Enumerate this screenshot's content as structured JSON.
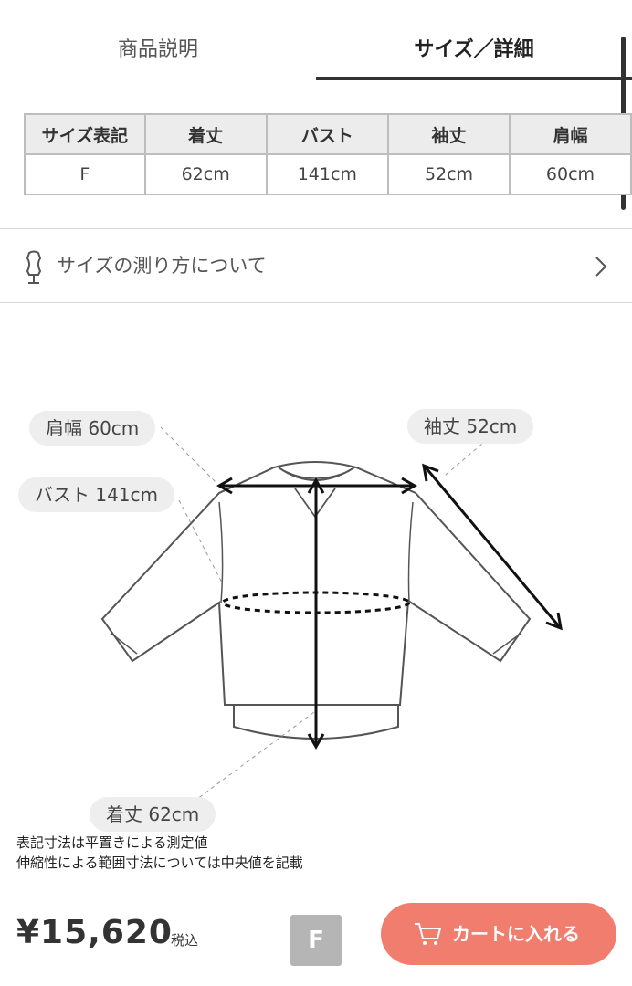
{
  "tabs": {
    "description": "商品説明",
    "size_details": "サイズ／詳細"
  },
  "size_table": {
    "headers": [
      "サイズ表記",
      "着丈",
      "バスト",
      "袖丈",
      "肩幅"
    ],
    "row": [
      "F",
      "62cm",
      "141cm",
      "52cm",
      "60cm"
    ]
  },
  "size_guide": {
    "label": "サイズの測り方について"
  },
  "diagram": {
    "shoulder": "肩幅 60cm",
    "sleeve": "袖丈 52cm",
    "bust": "バスト 141cm",
    "length": "着丈 62cm"
  },
  "notes": {
    "line1": "表記寸法は平置きによる測定値",
    "line2": "伸縮性による範囲寸法については中央値を記載"
  },
  "purchase": {
    "price": "¥15,620",
    "tax": "税込",
    "selected_size": "F",
    "cart_button": "カートに入れる"
  },
  "colors": {
    "accent": "#f07d6e",
    "badge": "#b5b5b5"
  }
}
